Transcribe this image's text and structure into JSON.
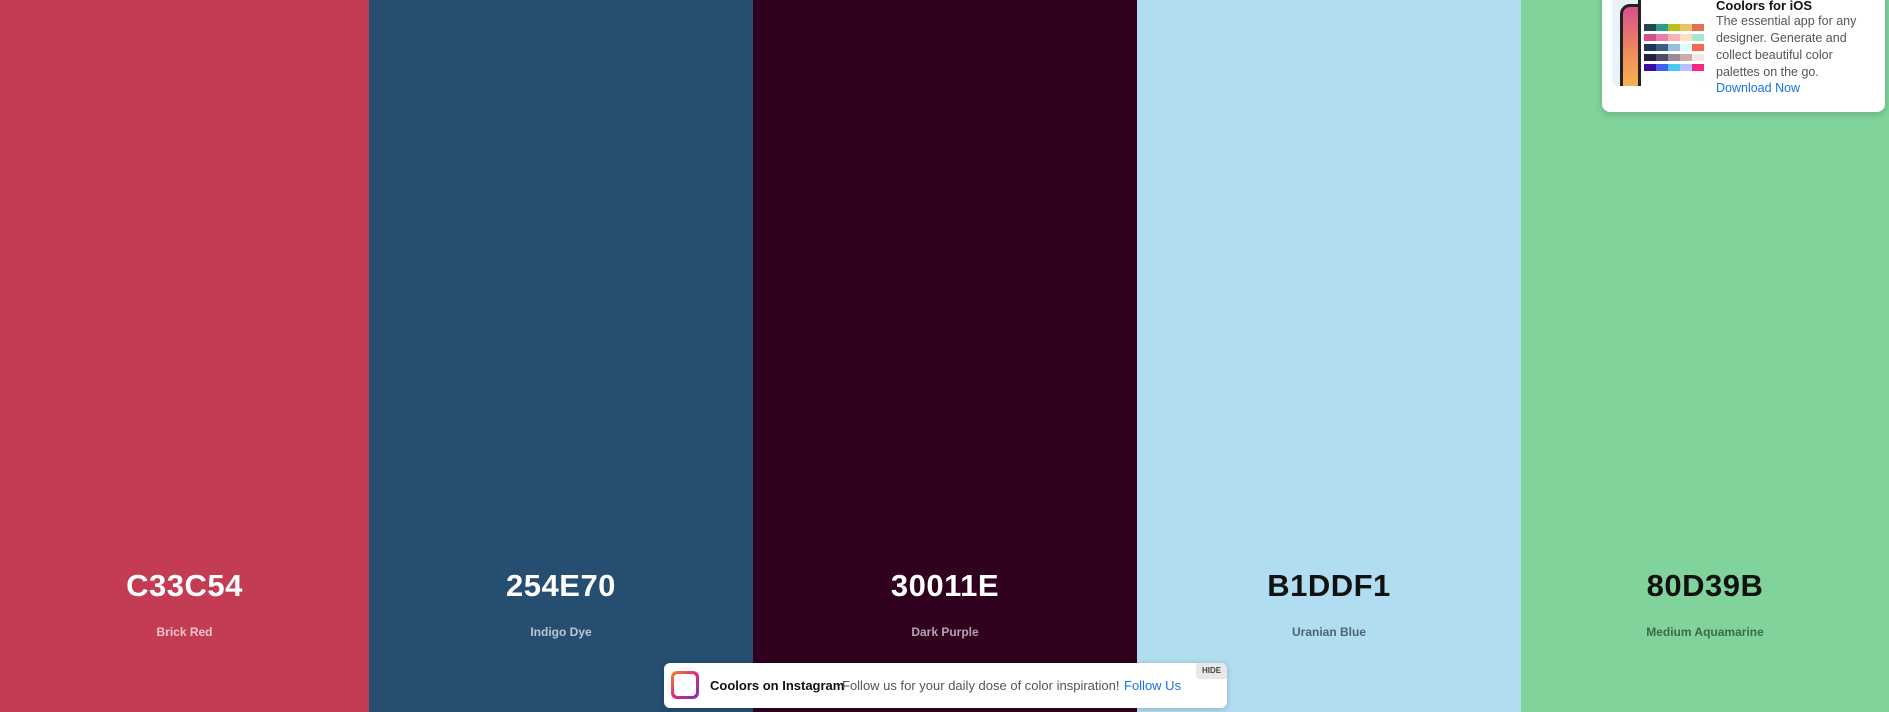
{
  "colors": [
    {
      "hex": "C33C54",
      "name": "Brick Red",
      "bg": "#C33C54",
      "text_color": "#FFFFFF",
      "name_color": "#F2C4CC"
    },
    {
      "hex": "254E70",
      "name": "Indigo Dye",
      "bg": "#254E70",
      "text_color": "#FFFFFF",
      "name_color": "#B9C7D4"
    },
    {
      "hex": "30011E",
      "name": "Dark Purple",
      "bg": "#30011E",
      "text_color": "#FFFFFF",
      "name_color": "#B7A3AE"
    },
    {
      "hex": "B1DDF1",
      "name": "Uranian Blue",
      "bg": "#B1DDF1",
      "text_color": "#111111",
      "name_color": "#4E6470"
    },
    {
      "hex": "80D39B",
      "name": "Medium Aquamarine",
      "bg": "#80D39B",
      "text_color": "#111111",
      "name_color": "#3D6A4B"
    }
  ],
  "ios_card": {
    "title": "Coolors for iOS",
    "description": "The essential app for any designer. Generate and collect beautiful color palettes on the go.",
    "link": "Download Now",
    "image_icon": "phone-app-preview-icon"
  },
  "instagram_bar": {
    "title": "Coolors on Instagram",
    "text": "Follow us for your daily dose of color inspiration!",
    "link": "Follow Us",
    "hide_label": "HIDE",
    "logo_icon": "instagram-logo-icon"
  }
}
